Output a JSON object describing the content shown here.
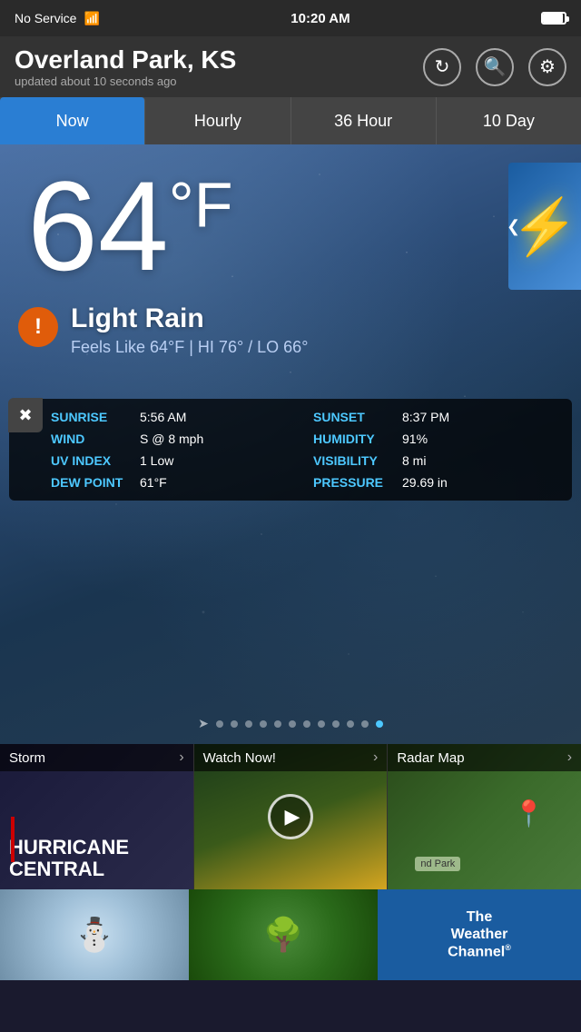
{
  "statusBar": {
    "signal": "No Service",
    "wifi": "wifi",
    "time": "10:20 AM",
    "battery": "battery"
  },
  "header": {
    "city": "Overland Park, KS",
    "updated": "updated about 10 seconds ago",
    "refreshIcon": "refresh",
    "searchIcon": "search",
    "settingsIcon": "settings"
  },
  "tabs": {
    "items": [
      {
        "id": "now",
        "label": "Now",
        "active": true
      },
      {
        "id": "hourly",
        "label": "Hourly",
        "active": false
      },
      {
        "id": "36hour",
        "label": "36 Hour",
        "active": false
      },
      {
        "id": "10day",
        "label": "10 Day",
        "active": false
      }
    ]
  },
  "weather": {
    "temperature": "64",
    "unit": "°F",
    "condition": "Light Rain",
    "feelsLike": "Feels Like 64°F | HI 76° / LO 66°",
    "alertIcon": "!",
    "details": {
      "sunrise": {
        "label": "SUNRISE",
        "value": "5:56 AM"
      },
      "sunset": {
        "label": "SUNSET",
        "value": "8:37 PM"
      },
      "wind": {
        "label": "WIND",
        "value": "S @ 8 mph"
      },
      "humidity": {
        "label": "HUMIDITY",
        "value": "91%"
      },
      "uvIndex": {
        "label": "UV INDEX",
        "value": "1 Low"
      },
      "visibility": {
        "label": "VISIBILITY",
        "value": "8 mi"
      },
      "dewPoint": {
        "label": "DEW POINT",
        "value": "61°F"
      },
      "pressure": {
        "label": "PRESSURE",
        "value": "29.69 in"
      }
    }
  },
  "cards": {
    "hurricane": {
      "label": "Storm",
      "title": "HURRICANE CENTRAL",
      "arrow": "›"
    },
    "watchNow": {
      "label": "Watch Now!",
      "arrow": "›"
    },
    "radar": {
      "label": "Radar Map",
      "arrow": "›",
      "locationLabel": "nd Park"
    }
  },
  "bottomStrip": {
    "twc": {
      "title": "The Weather Channel",
      "registered": "®"
    }
  }
}
